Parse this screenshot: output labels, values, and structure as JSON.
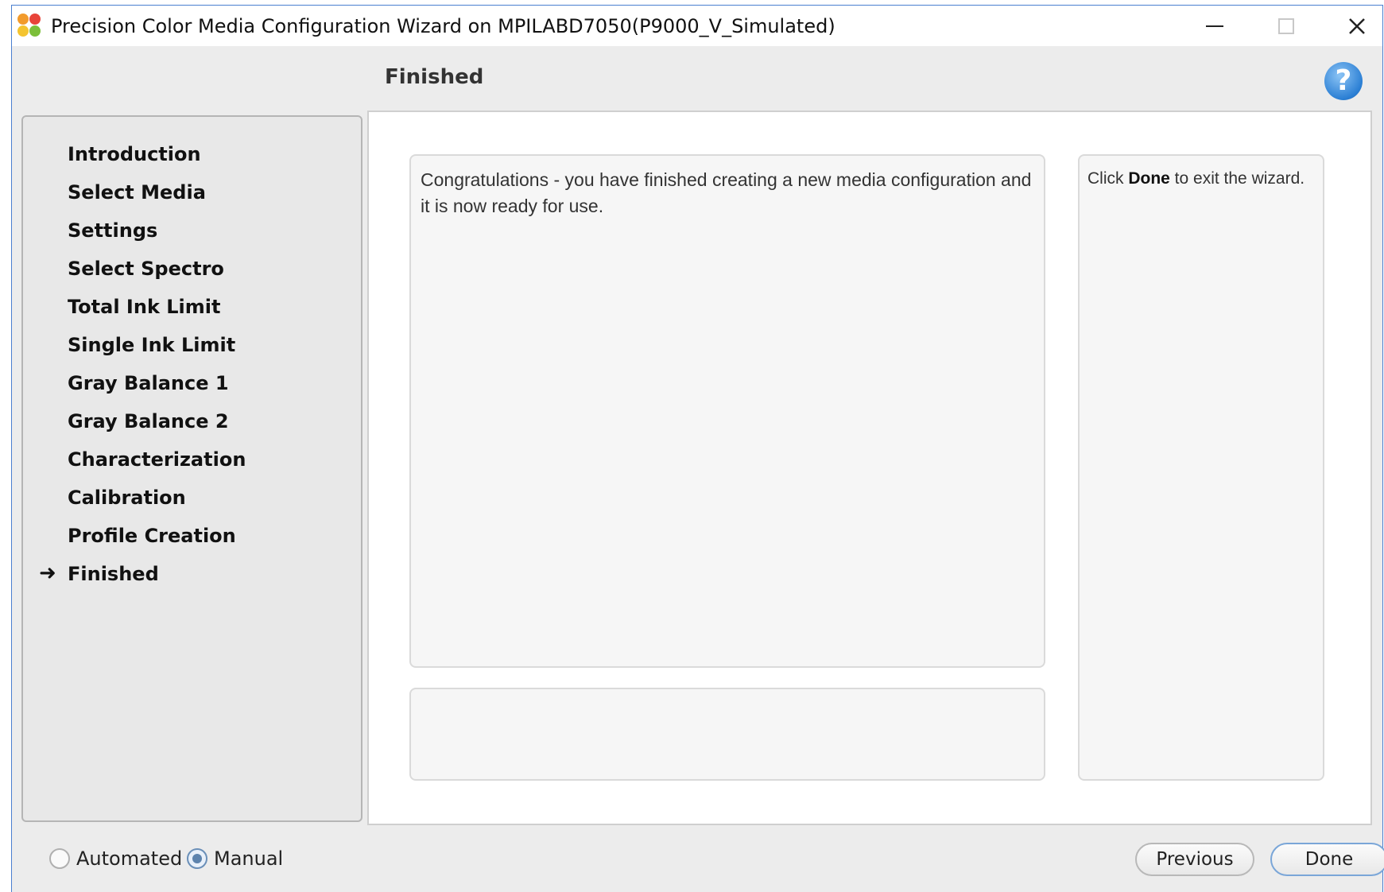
{
  "window": {
    "title": "Precision Color Media Configuration Wizard on MPILABD7050(P9000_V_Simulated)",
    "controls": {
      "minimize": "–",
      "maximize": "☐",
      "close": "✕"
    }
  },
  "header": {
    "title": "Finished",
    "help_icon": "?"
  },
  "steps": [
    {
      "label": "Introduction"
    },
    {
      "label": "Select Media"
    },
    {
      "label": "Settings"
    },
    {
      "label": "Select Spectro"
    },
    {
      "label": "Total Ink Limit"
    },
    {
      "label": "Single Ink Limit"
    },
    {
      "label": "Gray Balance 1"
    },
    {
      "label": "Gray Balance 2"
    },
    {
      "label": "Characterization"
    },
    {
      "label": "Calibration"
    },
    {
      "label": "Profile Creation"
    },
    {
      "label": "Finished"
    }
  ],
  "current_step_marker": "➜",
  "main": {
    "message": "Congratulations - you have finished creating a new media configuration and it is now ready for use.",
    "hint_prefix": "Click ",
    "hint_bold": "Done",
    "hint_suffix": " to exit the wizard."
  },
  "mode": {
    "automated_label": "Automated",
    "manual_label": "Manual",
    "selected": "Manual"
  },
  "footer": {
    "previous_label": "Previous",
    "done_label": "Done"
  },
  "colors": {
    "accent": "#4a7fd0",
    "help_blue": "#2b7fd4"
  }
}
